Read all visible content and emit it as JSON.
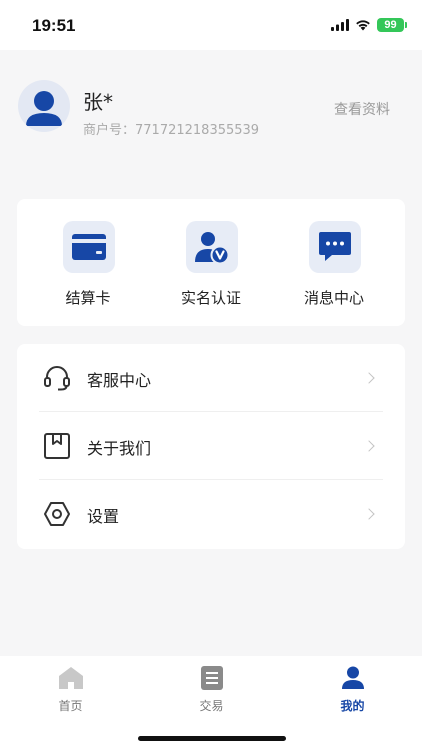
{
  "status_bar": {
    "time": "19:51",
    "battery": "99"
  },
  "profile": {
    "name": "张*",
    "merchant_label": "商户号：",
    "merchant_no": "771721218355539",
    "view_profile": "查看资料"
  },
  "quick_actions": [
    {
      "label": "结算卡",
      "icon": "card-icon"
    },
    {
      "label": "实名认证",
      "icon": "verified-user-icon"
    },
    {
      "label": "消息中心",
      "icon": "message-icon"
    }
  ],
  "menu": [
    {
      "label": "客服中心",
      "icon": "headset-icon"
    },
    {
      "label": "关于我们",
      "icon": "bookmark-box-icon"
    },
    {
      "label": "设置",
      "icon": "hexagon-settings-icon"
    }
  ],
  "tabs": [
    {
      "label": "首页",
      "icon": "home-icon"
    },
    {
      "label": "交易",
      "icon": "list-icon"
    },
    {
      "label": "我的",
      "icon": "person-icon",
      "active": true
    }
  ],
  "colors": {
    "accent": "#1747a6",
    "icon_bg": "#e7ecf6",
    "page_bg": "#f6f6f7"
  }
}
